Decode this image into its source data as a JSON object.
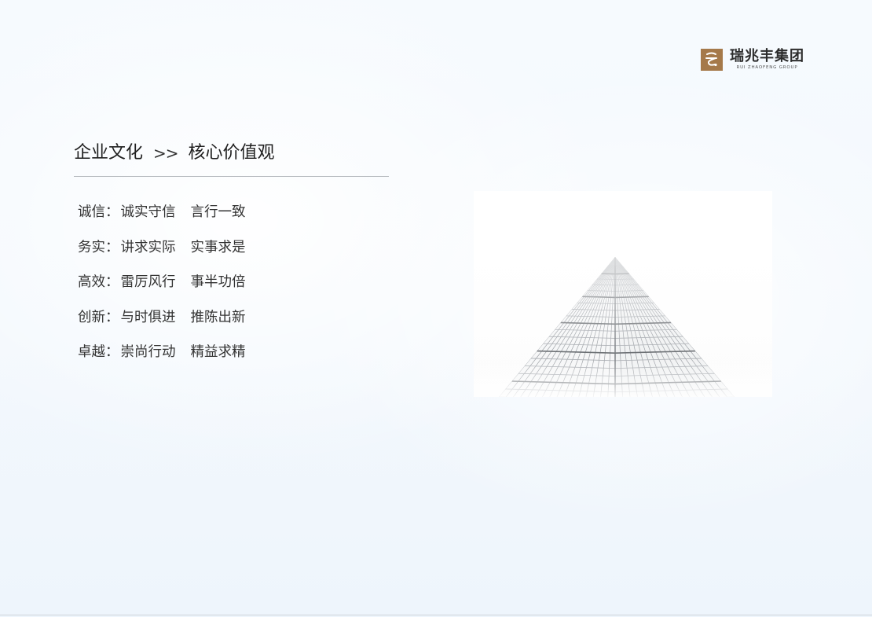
{
  "logo": {
    "mark_glyph": "ぢ",
    "name_cn": "瑞兆丰集团",
    "name_en": "RUI ZHAOFENG GROUP",
    "brand_color": "#a5794a"
  },
  "heading": {
    "section": "企业文化",
    "separator": ">>",
    "title": "核心价值观"
  },
  "values": [
    {
      "name": "诚信",
      "colon": "：",
      "phrase1": "诚实守信",
      "phrase2": "言行一致"
    },
    {
      "name": "务实",
      "colon": "：",
      "phrase1": "讲求实际",
      "phrase2": "实事求是"
    },
    {
      "name": "高效",
      "colon": "：",
      "phrase1": "雷厉风行",
      "phrase2": "事半功倍"
    },
    {
      "name": "创新",
      "colon": "：",
      "phrase1": "与时俱进",
      "phrase2": "推陈出新"
    },
    {
      "name": "卓越",
      "colon": "：",
      "phrase1": "崇尚行动",
      "phrase2": "精益求精"
    }
  ],
  "image": {
    "subject": "building-corner-perspective"
  }
}
